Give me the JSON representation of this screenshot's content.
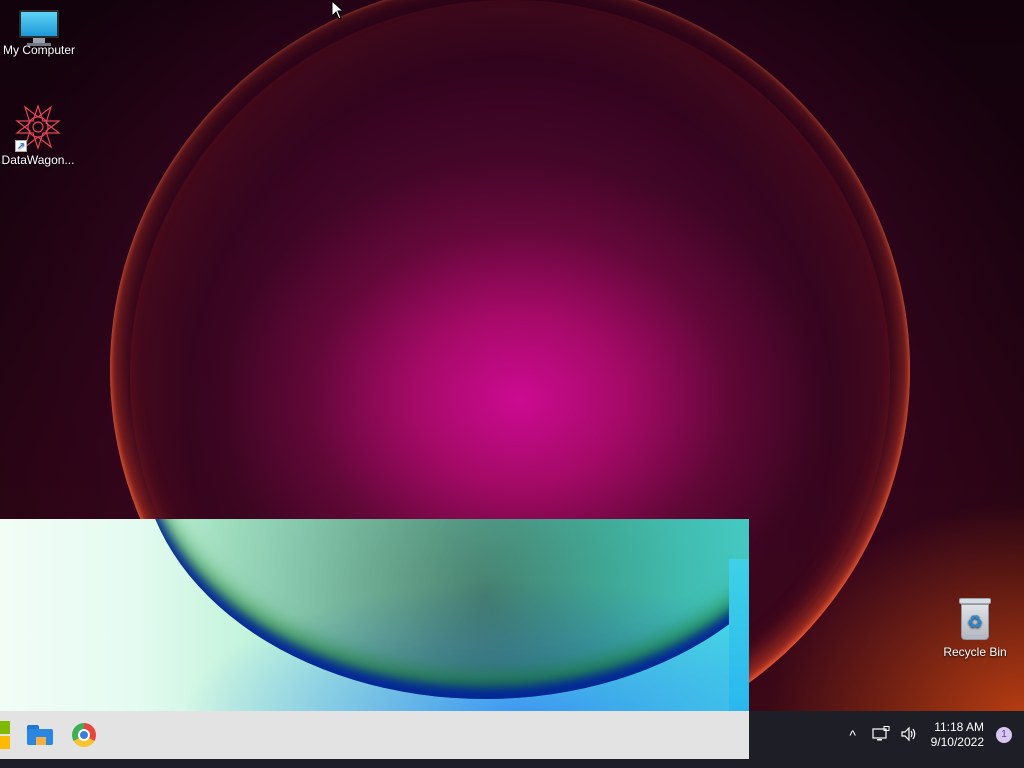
{
  "desktop": {
    "icons": [
      {
        "label": "My Computer",
        "icon": "monitor-icon"
      },
      {
        "label": "DataWagon...",
        "icon": "datawagon-app-icon"
      },
      {
        "label": "Recycle Bin",
        "icon": "recycle-bin-icon"
      }
    ]
  },
  "taskbar": {
    "pinned": [
      {
        "name": "start-button",
        "icon": "windows-logo-icon"
      },
      {
        "name": "file-explorer",
        "icon": "folder-icon"
      },
      {
        "name": "browser",
        "icon": "browser-icon"
      }
    ],
    "tray": {
      "chevron": "^",
      "time": "11:18 AM",
      "date": "9/10/2022",
      "notification_count": "1"
    }
  }
}
